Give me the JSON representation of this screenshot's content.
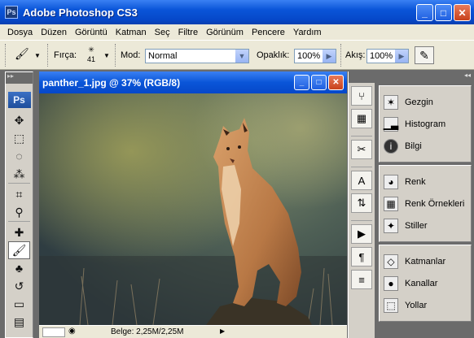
{
  "app": {
    "title": "Adobe Photoshop CS3",
    "logo": "Ps"
  },
  "window_buttons": {
    "minimize": "_",
    "maximize": "□",
    "close": "✕"
  },
  "menu": [
    "Dosya",
    "Düzen",
    "Görüntü",
    "Katman",
    "Seç",
    "Filtre",
    "Görünüm",
    "Pencere",
    "Yardım"
  ],
  "options": {
    "brush_label": "Fırça:",
    "brush_size": "41",
    "mode_label": "Mod:",
    "mode_value": "Normal",
    "opacity_label": "Opaklık:",
    "opacity_value": "100%",
    "flow_label": "Akış:",
    "flow_value": "100%"
  },
  "tools": {
    "logo": "Ps"
  },
  "document": {
    "title": "panther_1.jpg @ 37% (RGB/8)",
    "status_text": "Belge: 2,25M/2,25M"
  },
  "panels": {
    "group1": [
      {
        "label": "Gezgin",
        "icon": "navigator-icon"
      },
      {
        "label": "Histogram",
        "icon": "histogram-icon"
      },
      {
        "label": "Bilgi",
        "icon": "info-icon"
      }
    ],
    "group2": [
      {
        "label": "Renk",
        "icon": "color-icon"
      },
      {
        "label": "Renk Örnekleri",
        "icon": "swatches-icon"
      },
      {
        "label": "Stiller",
        "icon": "styles-icon"
      }
    ],
    "group3": [
      {
        "label": "Katmanlar",
        "icon": "layers-icon"
      },
      {
        "label": "Kanallar",
        "icon": "channels-icon"
      },
      {
        "label": "Yollar",
        "icon": "paths-icon"
      }
    ]
  }
}
